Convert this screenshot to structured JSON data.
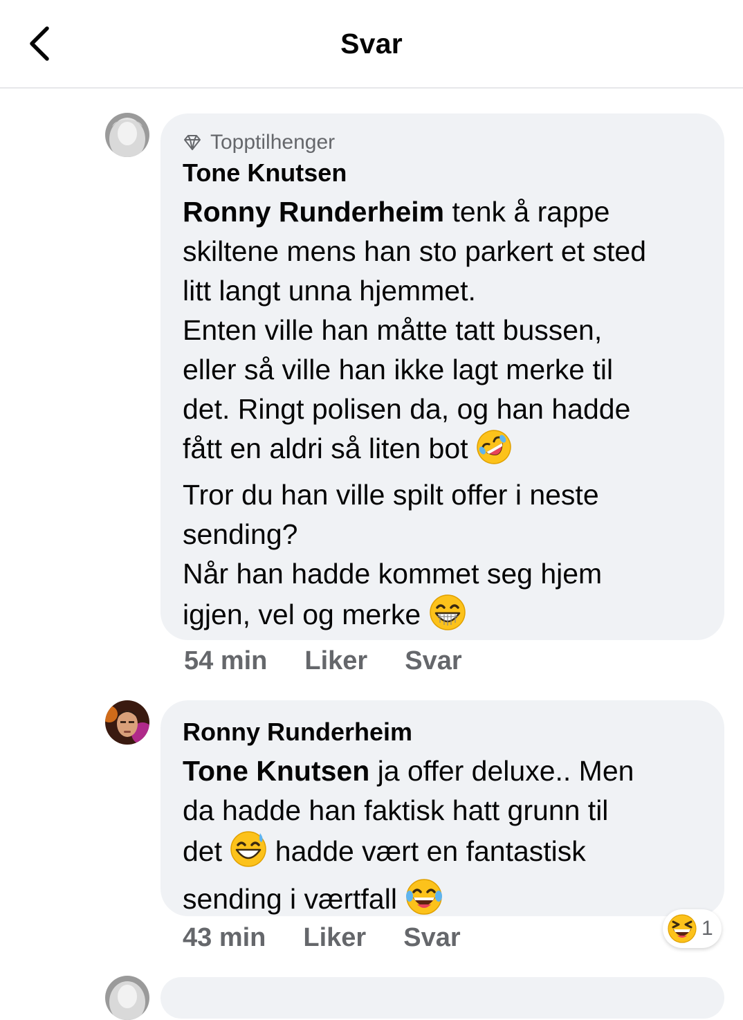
{
  "header": {
    "title": "Svar"
  },
  "comments": [
    {
      "badge": "Topptilhenger",
      "author": "Tone Knutsen",
      "mention": "Ronny Runderheim",
      "text_lines": [
        " tenk å rappe",
        "skiltene mens han sto parkert et sted",
        "litt langt unna hjemmet.",
        "Enten ville han måtte tatt bussen,",
        "eller så ville han ikke lagt merke til",
        "det. Ringt polisen da, og han hadde",
        "fått en aldri så liten bot ",
        "Tror du han ville spilt offer i neste",
        "sending?",
        "Når han hadde kommet seg hjem",
        "igjen, vel og merke "
      ],
      "emojis": [
        "rolling-on-floor-laughing",
        "grinning-squinting"
      ],
      "time": "54 min",
      "like_label": "Liker",
      "reply_label": "Svar"
    },
    {
      "author": "Ronny Runderheim",
      "mention": "Tone Knutsen",
      "text_lines": [
        " ja offer deluxe.. Men",
        "da hadde han faktisk hatt grunn til",
        "det ",
        " hadde vært en fantastisk",
        "sending i værtfall "
      ],
      "emojis": [
        "grinning-sweat",
        "tears-of-joy"
      ],
      "time": "43 min",
      "like_label": "Liker",
      "reply_label": "Svar",
      "reaction": {
        "icon": "laughing-squinting",
        "count": "1"
      }
    }
  ]
}
